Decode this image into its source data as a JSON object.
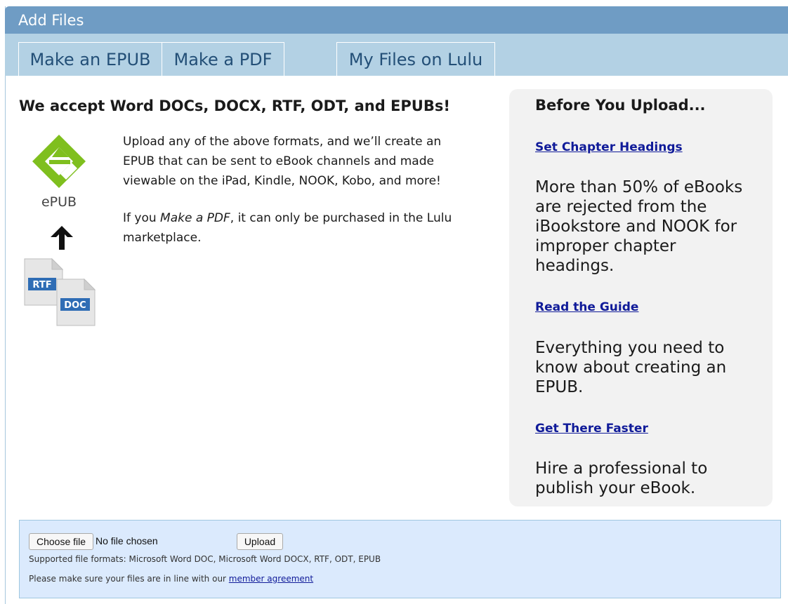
{
  "window": {
    "title": "Add Files"
  },
  "tabs": [
    {
      "label": "Make an EPUB"
    },
    {
      "label": "Make a PDF"
    },
    {
      "label": "My Files on Lulu"
    }
  ],
  "main": {
    "heading": "We accept Word DOCs, DOCX, RTF, ODT, and EPUBs!",
    "paragraph1": "Upload any of the above formats, and we’ll create an EPUB that can be sent to eBook channels and made viewable on the iPad, Kindle, NOOK, Kobo, and more!",
    "paragraph2_prefix": "If you ",
    "paragraph2_emphasis": "Make a PDF",
    "paragraph2_suffix": ", it can only be purchased in the Lulu marketplace.",
    "epub_logo_text": "ePUB",
    "rtf_label": "RTF",
    "doc_label": "DOC",
    "icons": [
      "epub-logo-icon",
      "up-arrow-icon",
      "rtf-file-icon",
      "doc-file-icon"
    ]
  },
  "sidebar": {
    "heading": "Before You Upload...",
    "items": [
      {
        "link": "Set Chapter Headings",
        "text": "More than 50% of eBooks are rejected from the iBookstore and NOOK for improper chapter headings."
      },
      {
        "link": "Read the Guide",
        "text": "Everything you need to know about creating an EPUB."
      },
      {
        "link": "Get There Faster",
        "text": "Hire a professional to publish your eBook."
      }
    ]
  },
  "upload": {
    "choose_label": "Choose file",
    "no_file": "No file chosen",
    "upload_label": "Upload",
    "formats_note": "Supported file formats: Microsoft Word DOC, Microsoft Word DOCX, RTF, ODT, EPUB",
    "agreement_prefix": "Please make sure your files are in line with our ",
    "agreement_link": "member agreement"
  },
  "colors": {
    "titlebar": "#6f9cc4",
    "tabbar": "#b3d1e4",
    "tab_text": "#234f77",
    "link": "#101b99",
    "sidebar_bg": "#f2f2f2",
    "upload_bg": "#dbeafd",
    "epub_green": "#7fbf1e"
  }
}
